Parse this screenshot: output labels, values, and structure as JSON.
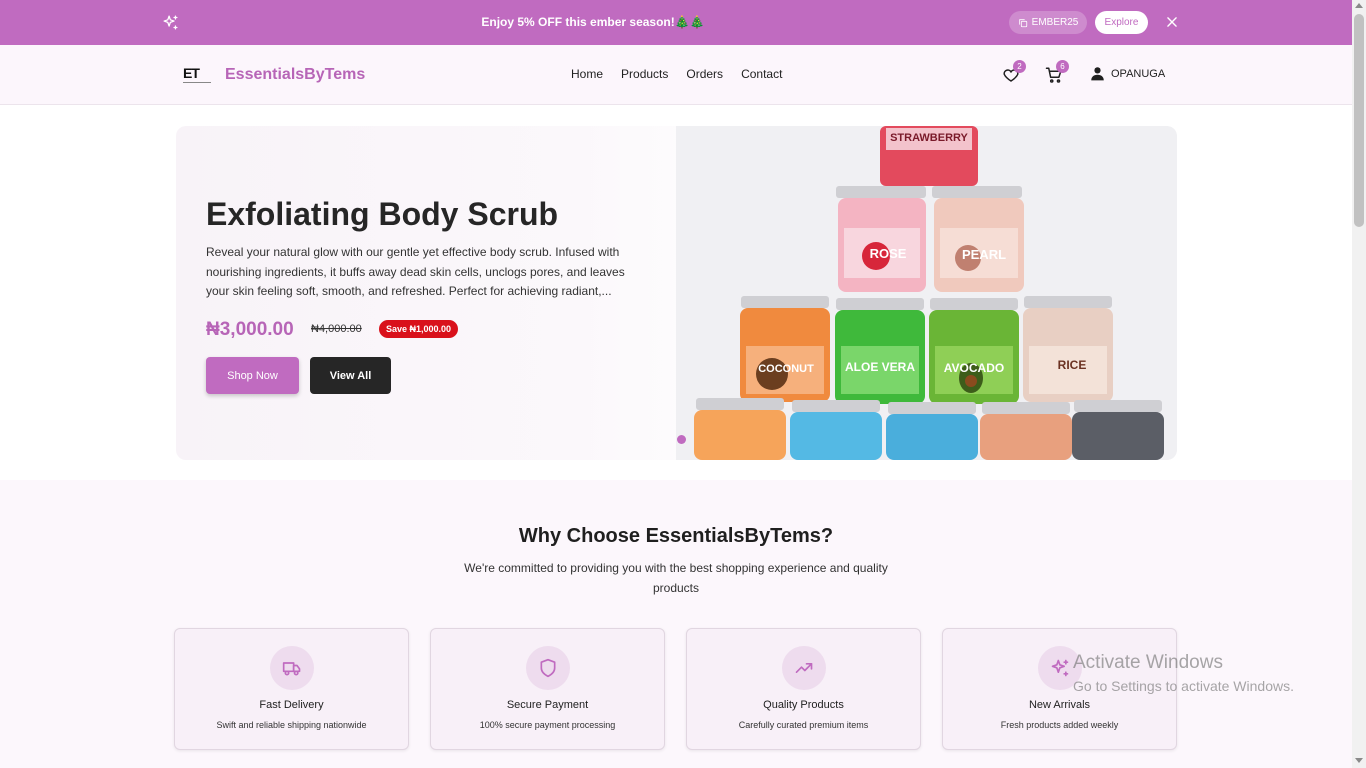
{
  "promo": {
    "message": "Enjoy 5% OFF this ember season!🎄🎄",
    "code": "EMBER25",
    "explore_label": "Explore"
  },
  "nav": {
    "brand": "EssentialsByTems",
    "logo_text": "ET",
    "links": [
      "Home",
      "Products",
      "Orders",
      "Contact"
    ],
    "wishlist_count": "2",
    "cart_count": "6",
    "user_name": "OPANUGA"
  },
  "hero": {
    "title": "Exfoliating Body Scrub",
    "description": "Reveal your natural glow with our gentle yet effective body scrub. Infused with nourishing ingredients, it buffs away dead skin cells, unclogs pores, and leaves your skin feeling soft, smooth, and refreshed. Perfect for achieving radiant,...",
    "price": "₦3,000.00",
    "old_price": "₦4,000.00",
    "save_label": "Save ₦1,000.00",
    "shop_label": "Shop Now",
    "view_label": "View All",
    "jar_labels": [
      "STRAWBERRY",
      "ROSE",
      "PEARL",
      "COCONUT",
      "ALOE VERA",
      "AVOCADO",
      "RICE"
    ]
  },
  "why": {
    "title": "Why Choose EssentialsByTems?",
    "subtitle": "We're committed to providing you with the best shopping experience and quality products",
    "features": [
      {
        "title": "Fast Delivery",
        "desc": "Swift and reliable shipping nationwide",
        "icon": "truck-icon"
      },
      {
        "title": "Secure Payment",
        "desc": "100% secure payment processing",
        "icon": "shield-icon"
      },
      {
        "title": "Quality Products",
        "desc": "Carefully curated premium items",
        "icon": "trending-up-icon"
      },
      {
        "title": "New Arrivals",
        "desc": "Fresh products added weekly",
        "icon": "sparkles-icon"
      }
    ]
  },
  "watermark": {
    "line1": "Activate Windows",
    "line2": "Go to Settings to activate Windows."
  },
  "colors": {
    "accent": "#c06bc0",
    "brand_text": "#b765b7",
    "dark": "#262626",
    "sale_red": "#d9111b"
  }
}
